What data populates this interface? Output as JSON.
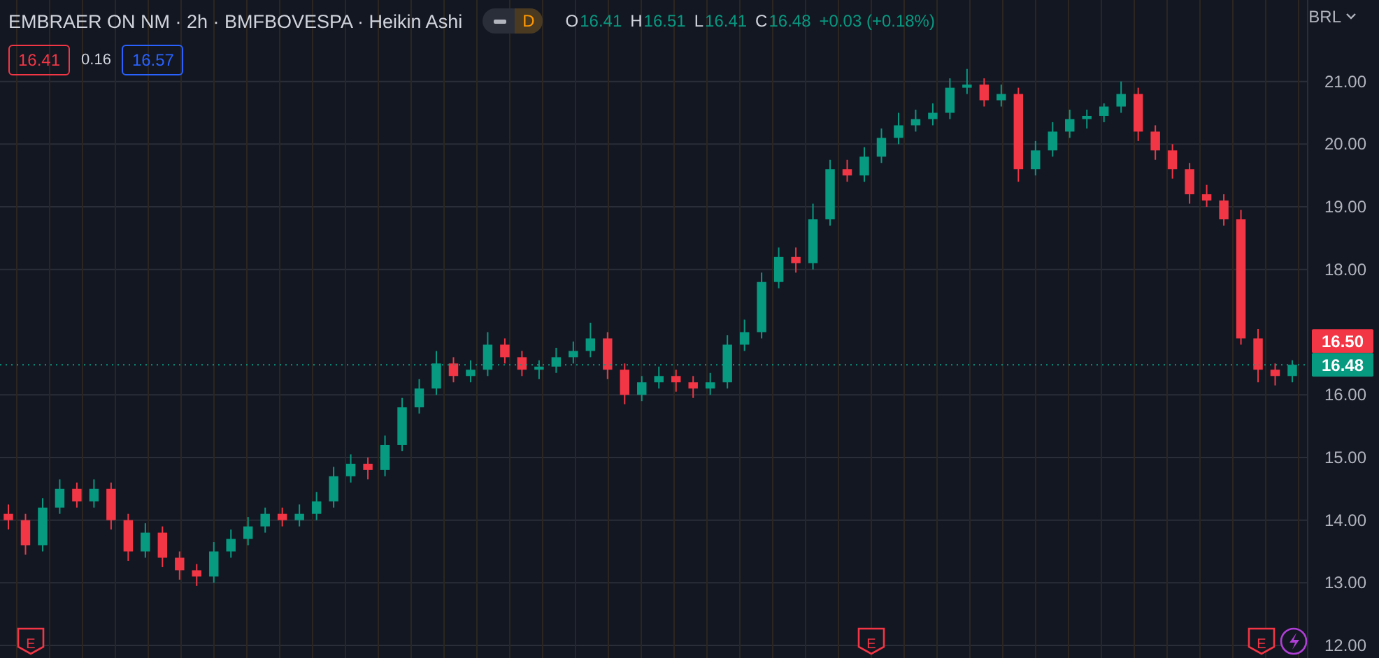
{
  "header": {
    "title": "EMBRAER ON NM · 2h · BMFBOVESPA · Heikin Ashi",
    "badge": "D",
    "ohlc": [
      {
        "key": "O",
        "value": "16.41"
      },
      {
        "key": "H",
        "value": "16.51"
      },
      {
        "key": "L",
        "value": "16.41"
      },
      {
        "key": "C",
        "value": "16.48"
      }
    ],
    "change": "+0.03 (+0.18%)"
  },
  "quote": {
    "bid": "16.41",
    "spread": "0.16",
    "ask": "16.57"
  },
  "currency": "BRL",
  "chart": {
    "chart_data": {
      "type": "candlestick",
      "grid": true,
      "ylim": [
        11.8,
        22.3
      ],
      "yticks": [
        {
          "value": 12,
          "label": "12.00"
        },
        {
          "value": 13,
          "label": "13.00"
        },
        {
          "value": 14,
          "label": "14.00"
        },
        {
          "value": 15,
          "label": "15.00"
        },
        {
          "value": 16,
          "label": "16.00"
        },
        {
          "value": 18,
          "label": "18.00"
        },
        {
          "value": 19,
          "label": "19.00"
        },
        {
          "value": 20,
          "label": "20.00"
        },
        {
          "value": 21,
          "label": "21.00"
        }
      ],
      "ref_lines": [
        {
          "axis": "y",
          "value": 16.48,
          "label": "16.48",
          "color": "#089981"
        }
      ],
      "ohlc": [
        [
          14.1,
          14.25,
          13.85,
          14.0
        ],
        [
          14.0,
          14.1,
          13.45,
          13.6
        ],
        [
          13.6,
          14.35,
          13.5,
          14.2
        ],
        [
          14.2,
          14.65,
          14.1,
          14.5
        ],
        [
          14.5,
          14.6,
          14.2,
          14.3
        ],
        [
          14.3,
          14.65,
          14.2,
          14.5
        ],
        [
          14.5,
          14.6,
          13.85,
          14.0
        ],
        [
          14.0,
          14.1,
          13.35,
          13.5
        ],
        [
          13.5,
          13.95,
          13.4,
          13.8
        ],
        [
          13.8,
          13.9,
          13.25,
          13.4
        ],
        [
          13.4,
          13.5,
          13.05,
          13.2
        ],
        [
          13.2,
          13.3,
          12.95,
          13.1
        ],
        [
          13.1,
          13.65,
          13.0,
          13.5
        ],
        [
          13.5,
          13.85,
          13.4,
          13.7
        ],
        [
          13.7,
          14.05,
          13.6,
          13.9
        ],
        [
          13.9,
          14.2,
          13.8,
          14.1
        ],
        [
          14.1,
          14.2,
          13.9,
          14.0
        ],
        [
          14.0,
          14.25,
          13.9,
          14.1
        ],
        [
          14.1,
          14.45,
          14.0,
          14.3
        ],
        [
          14.3,
          14.85,
          14.2,
          14.7
        ],
        [
          14.7,
          15.05,
          14.6,
          14.9
        ],
        [
          14.9,
          15.0,
          14.65,
          14.8
        ],
        [
          14.8,
          15.35,
          14.7,
          15.2
        ],
        [
          15.2,
          15.95,
          15.1,
          15.8
        ],
        [
          15.8,
          16.25,
          15.7,
          16.1
        ],
        [
          16.1,
          16.7,
          16.0,
          16.5
        ],
        [
          16.5,
          16.6,
          16.2,
          16.3
        ],
        [
          16.3,
          16.55,
          16.2,
          16.4
        ],
        [
          16.4,
          17.0,
          16.3,
          16.8
        ],
        [
          16.8,
          16.9,
          16.5,
          16.6
        ],
        [
          16.6,
          16.7,
          16.3,
          16.4
        ],
        [
          16.4,
          16.55,
          16.25,
          16.45
        ],
        [
          16.45,
          16.75,
          16.35,
          16.6
        ],
        [
          16.6,
          16.85,
          16.5,
          16.7
        ],
        [
          16.7,
          17.15,
          16.6,
          16.9
        ],
        [
          16.9,
          17.0,
          16.25,
          16.4
        ],
        [
          16.4,
          16.5,
          15.85,
          16.0
        ],
        [
          16.0,
          16.3,
          15.9,
          16.2
        ],
        [
          16.2,
          16.45,
          16.1,
          16.3
        ],
        [
          16.3,
          16.4,
          16.05,
          16.2
        ],
        [
          16.2,
          16.3,
          15.95,
          16.1
        ],
        [
          16.1,
          16.35,
          16.0,
          16.2
        ],
        [
          16.2,
          16.95,
          16.1,
          16.8
        ],
        [
          16.8,
          17.2,
          16.7,
          17.0
        ],
        [
          17.0,
          17.95,
          16.9,
          17.8
        ],
        [
          17.8,
          18.35,
          17.7,
          18.2
        ],
        [
          18.2,
          18.35,
          17.95,
          18.1
        ],
        [
          18.1,
          19.05,
          18.0,
          18.8
        ],
        [
          18.8,
          19.75,
          18.7,
          19.6
        ],
        [
          19.6,
          19.75,
          19.4,
          19.5
        ],
        [
          19.5,
          19.95,
          19.4,
          19.8
        ],
        [
          19.8,
          20.25,
          19.7,
          20.1
        ],
        [
          20.1,
          20.5,
          20.0,
          20.3
        ],
        [
          20.3,
          20.55,
          20.2,
          20.4
        ],
        [
          20.4,
          20.65,
          20.3,
          20.5
        ],
        [
          20.5,
          21.05,
          20.4,
          20.9
        ],
        [
          20.9,
          21.2,
          20.8,
          20.95
        ],
        [
          20.95,
          21.05,
          20.6,
          20.7
        ],
        [
          20.7,
          20.95,
          20.6,
          20.8
        ],
        [
          20.8,
          20.9,
          19.4,
          19.6
        ],
        [
          19.6,
          20.05,
          19.5,
          19.9
        ],
        [
          19.9,
          20.35,
          19.8,
          20.2
        ],
        [
          20.2,
          20.55,
          20.1,
          20.4
        ],
        [
          20.4,
          20.55,
          20.25,
          20.45
        ],
        [
          20.45,
          20.65,
          20.35,
          20.6
        ],
        [
          20.6,
          21.0,
          20.5,
          20.8
        ],
        [
          20.8,
          20.9,
          20.05,
          20.2
        ],
        [
          20.2,
          20.3,
          19.75,
          19.9
        ],
        [
          19.9,
          20.0,
          19.45,
          19.6
        ],
        [
          19.6,
          19.7,
          19.05,
          19.2
        ],
        [
          19.2,
          19.35,
          19.0,
          19.1
        ],
        [
          19.1,
          19.2,
          18.7,
          18.8
        ],
        [
          18.8,
          18.95,
          16.8,
          16.9
        ],
        [
          16.9,
          17.05,
          16.2,
          16.4
        ],
        [
          16.4,
          16.5,
          16.15,
          16.3
        ],
        [
          16.3,
          16.55,
          16.2,
          16.48
        ]
      ]
    }
  },
  "events": [
    {
      "kind": "earnings",
      "label": "E"
    },
    {
      "kind": "earnings",
      "label": "E"
    },
    {
      "kind": "earnings",
      "label": "E"
    },
    {
      "kind": "flash"
    }
  ],
  "price_labels": [
    {
      "text": "16.50",
      "color": "#f23645"
    }
  ]
}
